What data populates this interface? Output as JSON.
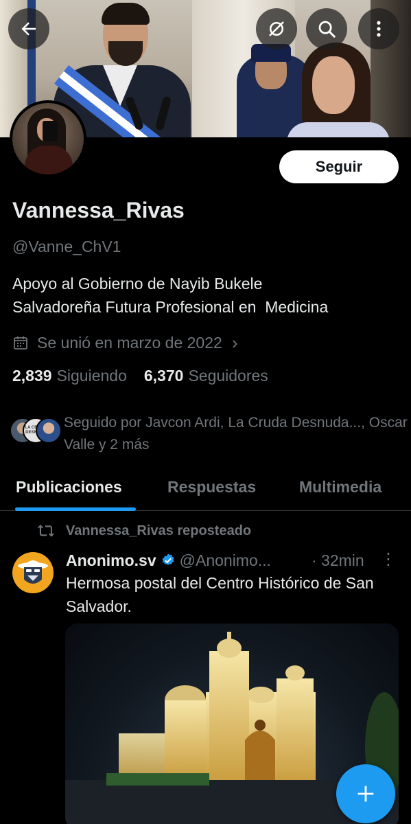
{
  "profile": {
    "name": "Vannessa_Rivas",
    "handle": "@Vanne_ChV1",
    "bio_lines": [
      "Apoyo al Gobierno de Nayib Bukele",
      "Salvadoreña Futura Profesional en  Medicina"
    ],
    "joined": "Se unió en marzo de 2022",
    "following_count": "2,839",
    "following_label": "Siguiendo",
    "followers_count": "6,370",
    "followers_label": "Seguidores",
    "followed_by": "Seguido por Javcon Ardi, La Cruda Desnuda..., Oscar Valle y 2 más",
    "follow_button": "Seguir",
    "followed_by_avatar_text": "LA CRUDA DESNUDA"
  },
  "top_bar": {
    "back_icon": "arrow-left-icon",
    "hide_icon": "eye-slash-icon",
    "search_icon": "search-icon",
    "more_icon": "more-vertical-icon"
  },
  "tabs": [
    "Publicaciones",
    "Respuestas",
    "Multimedia"
  ],
  "active_tab": "Publicaciones",
  "post": {
    "repost_label": "Vannessa_Rivas reposteado",
    "author": "Anonimo.sv",
    "handle": "@Anonimo...",
    "time": "· 32min",
    "text": "Hermosa postal del Centro Histórico de San Salvador."
  },
  "colors": {
    "accent": "#1d9bf0",
    "background": "#000000",
    "text_primary": "#e7e9ea",
    "text_secondary": "#71767b"
  }
}
